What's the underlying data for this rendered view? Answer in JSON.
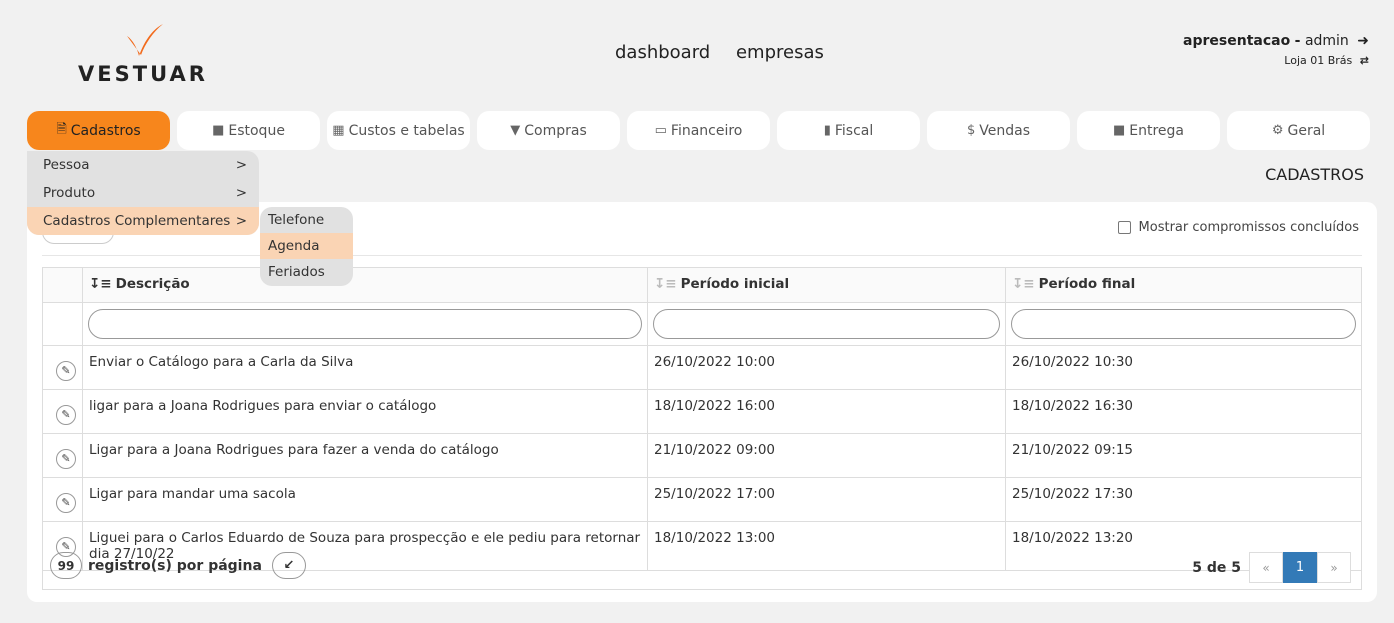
{
  "brand": {
    "name": "VESTUAR",
    "accent": "#f7861c"
  },
  "topnav": [
    "dashboard",
    "empresas"
  ],
  "user": {
    "company": "apresentacao",
    "separator": "-",
    "name": "admin",
    "store": "Loja 01 Brás",
    "logout_icon": "sign-out-icon",
    "switch_icon": "switch-icon"
  },
  "tabs": [
    {
      "label": "Cadastros",
      "icon": "file-icon"
    },
    {
      "label": "Estoque",
      "icon": "truck-icon"
    },
    {
      "label": "Custos e tabelas",
      "icon": "table-icon"
    },
    {
      "label": "Compras",
      "icon": "cart-icon"
    },
    {
      "label": "Financeiro",
      "icon": "card-icon"
    },
    {
      "label": "Fiscal",
      "icon": "document-icon"
    },
    {
      "label": "Vendas",
      "icon": "dollar-icon"
    },
    {
      "label": "Entrega",
      "icon": "truck-icon"
    },
    {
      "label": "Geral",
      "icon": "gears-icon"
    }
  ],
  "menu": [
    {
      "label": "Pessoa",
      "arrow": ">"
    },
    {
      "label": "Produto",
      "arrow": ">"
    },
    {
      "label": "Cadastros Complementares",
      "arrow": ">"
    }
  ],
  "submenu": [
    "Telefone",
    "Agenda",
    "Feriados"
  ],
  "section_title": "CADASTROS",
  "show_completed_label": "Mostrar compromissos concluídos",
  "table": {
    "columns": [
      "Descrição",
      "Período inicial",
      "Período final"
    ],
    "rows": [
      [
        "Enviar o Catálogo para a Carla da Silva",
        "26/10/2022 10:00",
        "26/10/2022 10:30"
      ],
      [
        "ligar para a Joana Rodrigues para enviar o catálogo",
        "18/10/2022 16:00",
        "18/10/2022 16:30"
      ],
      [
        "Ligar para a Joana Rodrigues para fazer a venda do catálogo",
        "21/10/2022 09:00",
        "21/10/2022 09:15"
      ],
      [
        "Ligar para mandar uma sacola",
        "25/10/2022 17:00",
        "25/10/2022 17:30"
      ],
      [
        "Liguei para o Carlos Eduardo de Souza para prospecção e ele pediu para retornar dia 27/10/22",
        "18/10/2022 13:00",
        "18/10/2022 13:20"
      ]
    ]
  },
  "footer": {
    "per_page": "99",
    "per_page_label": "registro(s) por página",
    "count": "5 de 5",
    "prev": "«",
    "page": "1",
    "next": "»"
  }
}
